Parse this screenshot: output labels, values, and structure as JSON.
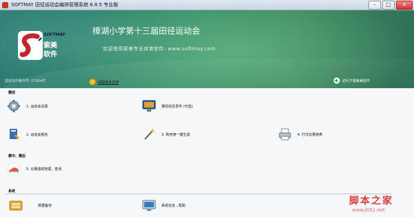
{
  "window": {
    "title": "SOFTMAY 田径运动会编排管理系统 8.8.5  专业版",
    "buttons": [
      "-",
      "□",
      "×"
    ]
  },
  "banner": {
    "logo": {
      "brand": "SOFTMAY",
      "name": "索美软件"
    },
    "event_title": "樟湖小学第十三届田径运动会",
    "welcome": "欢迎使用索美专业体育软件: www.softmay.com",
    "version": "国家软件著作号: 07664号",
    "support_link": "获取技术支持",
    "download_link": "访问下载索美软件"
  },
  "sections": {
    "pre_game": "赛前",
    "in_game": "赛中、赛后",
    "system": "系统"
  },
  "items": {
    "settings": "1. 运动会设置",
    "broadcast": "赛前信息发布 (可选)",
    "register": "2. 运动会报名",
    "schedule": "3. 秩序册一键生成",
    "print": "4. 打印比赛用表",
    "results": "5. 比赛成绩管理 , 查询",
    "backup": "数据备份",
    "sysinfo": "系统信息 , 帮助"
  },
  "watermark": {
    "title": "脚本之家",
    "url": "www.jb51.net"
  },
  "colors": {
    "banner_green": "#3a8f6a",
    "watermark_red": "#d94040"
  }
}
